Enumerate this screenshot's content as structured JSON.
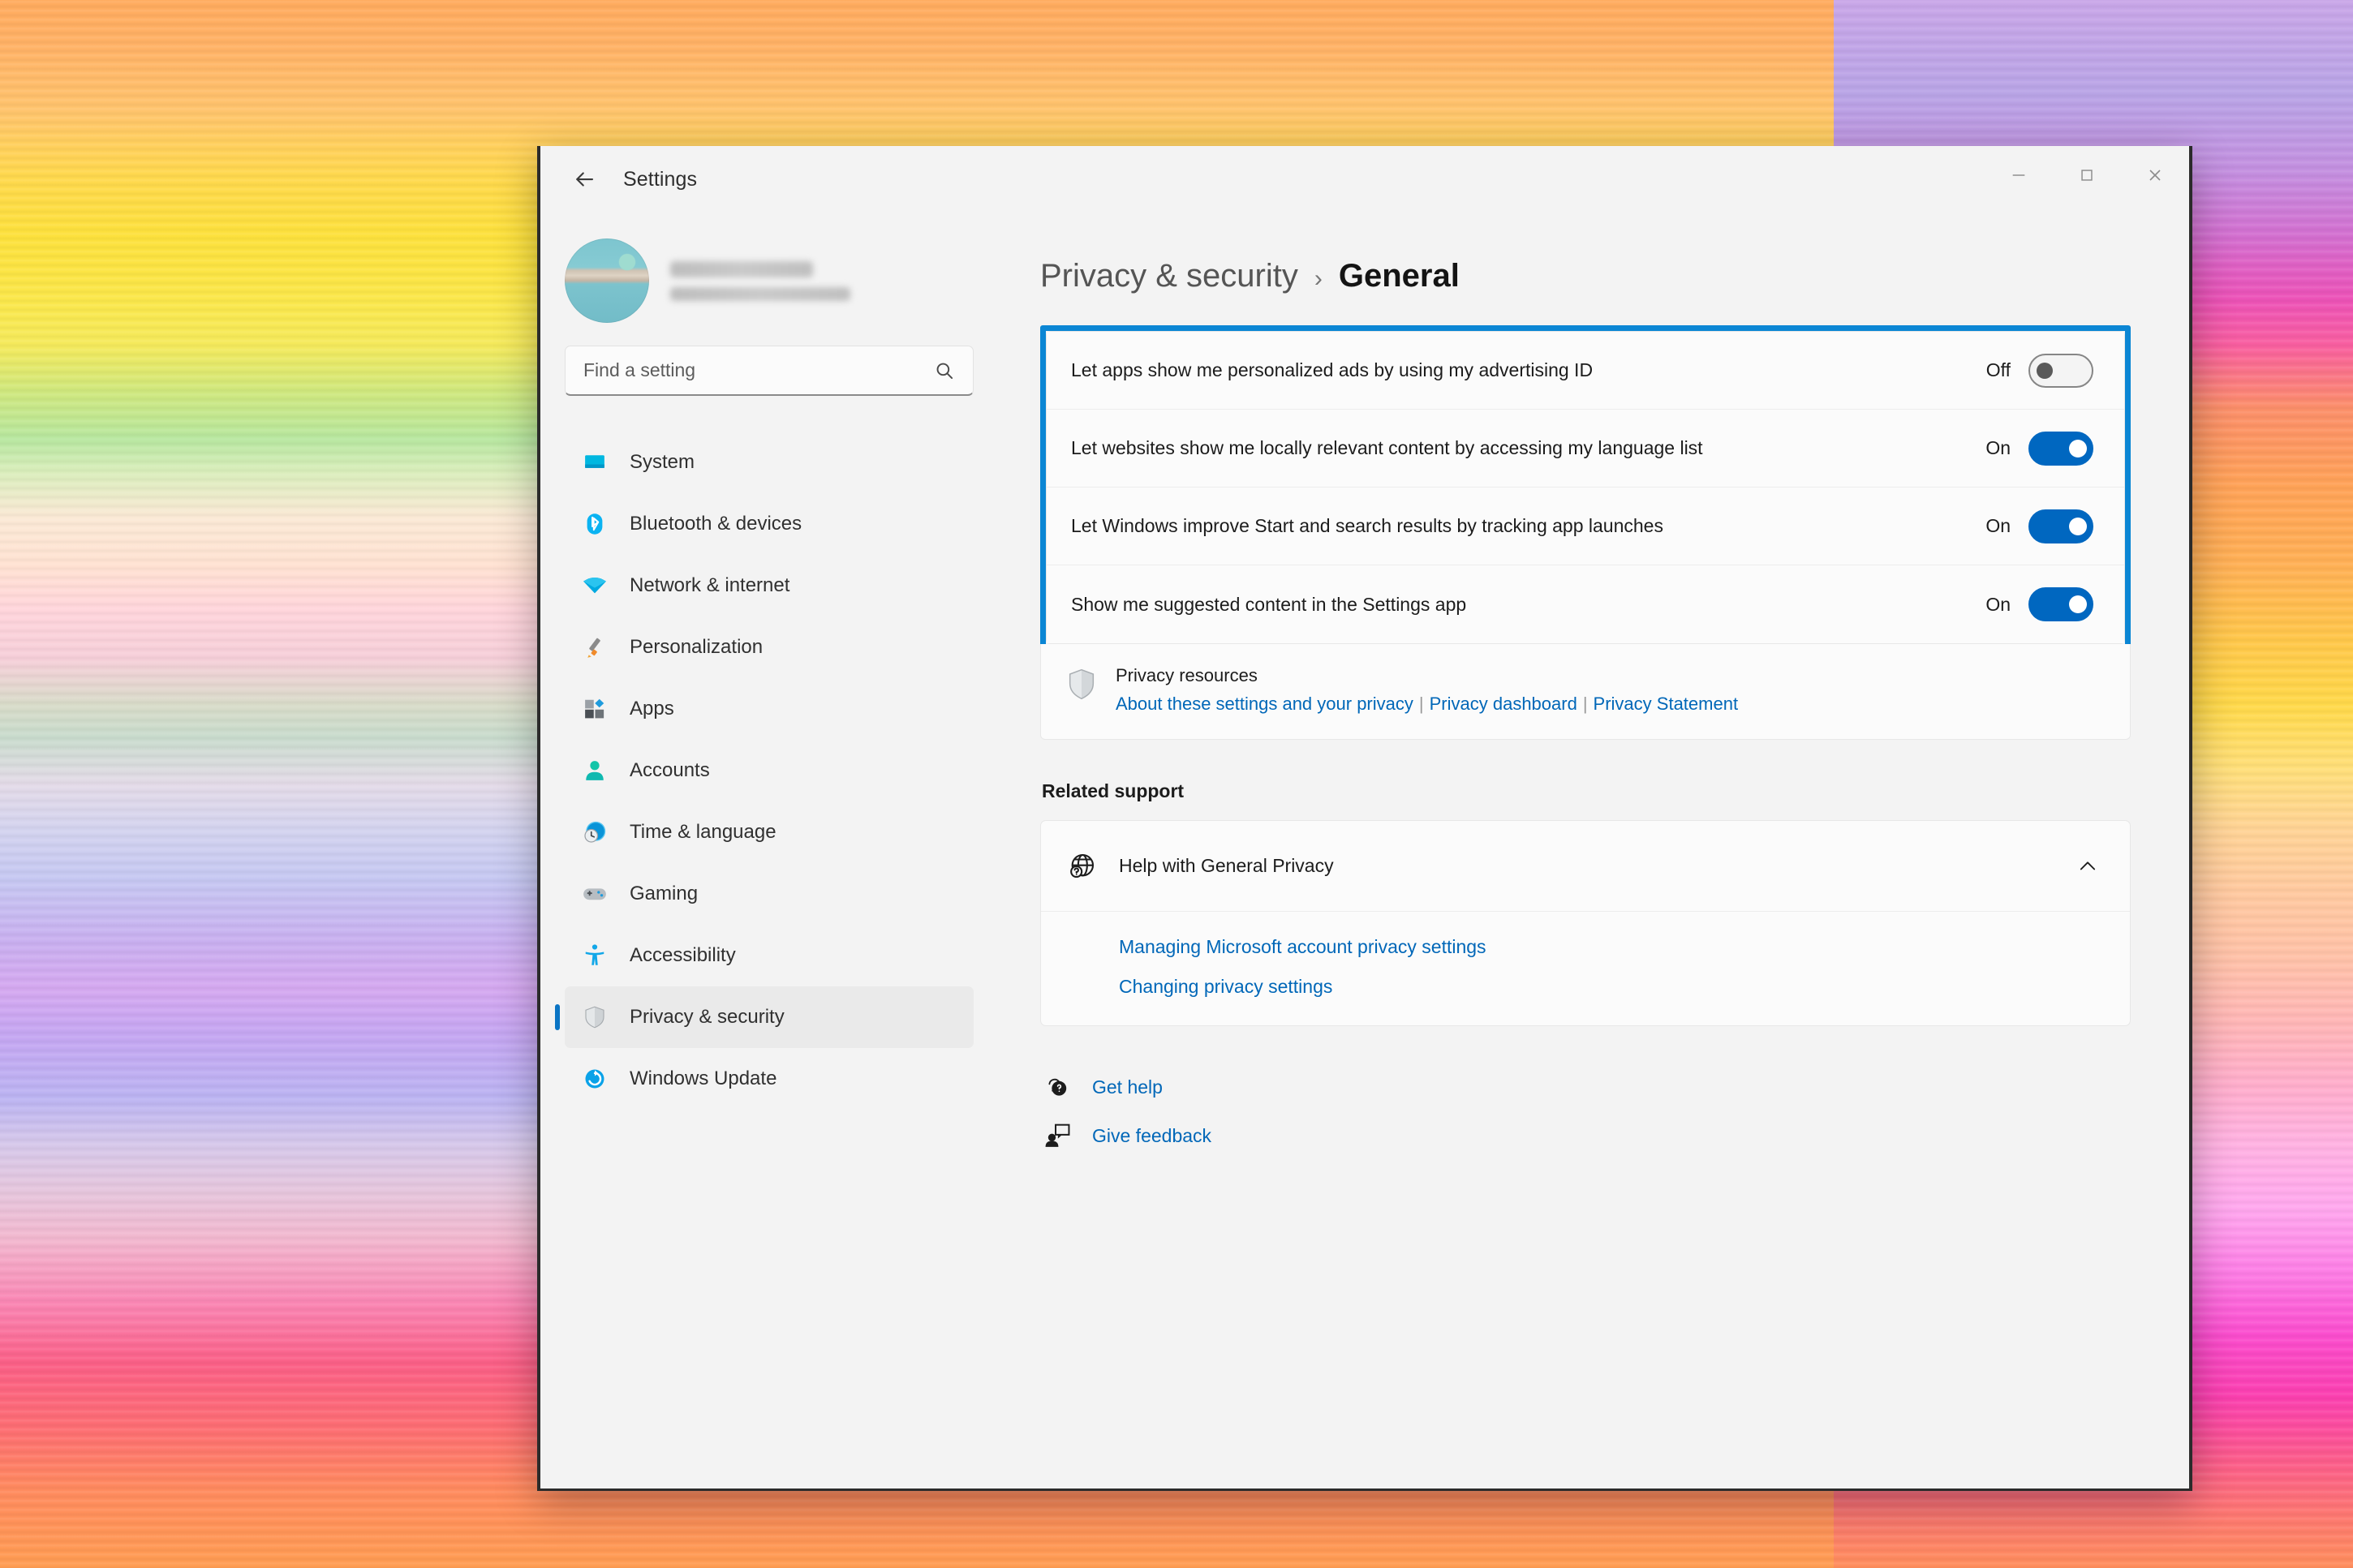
{
  "window": {
    "app_title": "Settings",
    "back_icon": "back-arrow-icon",
    "controls": {
      "minimize": "minimize-icon",
      "maximize": "maximize-icon",
      "close": "close-icon"
    }
  },
  "sidebar": {
    "account": {
      "name": "",
      "email": "",
      "avatar": "user-avatar"
    },
    "search": {
      "placeholder": "Find a setting",
      "icon": "search-icon"
    },
    "items": [
      {
        "label": "System",
        "icon": "monitor-icon",
        "active": false
      },
      {
        "label": "Bluetooth & devices",
        "icon": "bluetooth-icon",
        "active": false
      },
      {
        "label": "Network & internet",
        "icon": "wifi-icon",
        "active": false
      },
      {
        "label": "Personalization",
        "icon": "paintbrush-icon",
        "active": false
      },
      {
        "label": "Apps",
        "icon": "apps-grid-icon",
        "active": false
      },
      {
        "label": "Accounts",
        "icon": "person-icon",
        "active": false
      },
      {
        "label": "Time & language",
        "icon": "clock-globe-icon",
        "active": false
      },
      {
        "label": "Gaming",
        "icon": "gamepad-icon",
        "active": false
      },
      {
        "label": "Accessibility",
        "icon": "accessibility-icon",
        "active": false
      },
      {
        "label": "Privacy & security",
        "icon": "shield-icon",
        "active": true
      },
      {
        "label": "Windows Update",
        "icon": "update-icon",
        "active": false
      }
    ]
  },
  "content": {
    "breadcrumb": {
      "parent": "Privacy & security",
      "separator": "›",
      "current": "General"
    },
    "highlight_color": "#0b86d4",
    "toggles": [
      {
        "label": "Let apps show me personalized ads by using my advertising ID",
        "state": "Off",
        "on": false
      },
      {
        "label": "Let websites show me locally relevant content by accessing my language list",
        "state": "On",
        "on": true
      },
      {
        "label": "Let Windows improve Start and search results by tracking app launches",
        "state": "On",
        "on": true
      },
      {
        "label": "Show me suggested content in the Settings app",
        "state": "On",
        "on": true
      }
    ],
    "privacy_resources": {
      "icon": "shield-icon",
      "title": "Privacy resources",
      "links": [
        "About these settings and your privacy",
        "Privacy dashboard",
        "Privacy Statement"
      ],
      "separator": "|"
    },
    "related_support": {
      "heading": "Related support",
      "expander": {
        "icon": "help-globe-icon",
        "label": "Help with General Privacy",
        "chevron": "chevron-up-icon",
        "expanded": true
      },
      "links": [
        "Managing Microsoft account privacy settings",
        "Changing privacy settings"
      ]
    },
    "footer": [
      {
        "label": "Get help",
        "icon": "help-question-icon"
      },
      {
        "label": "Give feedback",
        "icon": "feedback-icon"
      }
    ]
  }
}
